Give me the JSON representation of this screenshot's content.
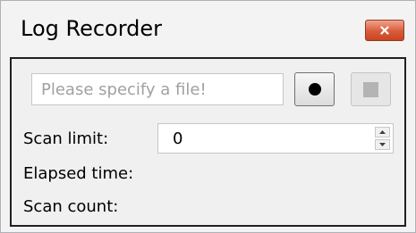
{
  "window": {
    "title": "Log Recorder"
  },
  "close_button": {
    "icon": "close-icon",
    "color": "#d95b3a"
  },
  "file": {
    "placeholder": "Please specify a file!",
    "value": ""
  },
  "toolbar": {
    "record_icon": "record-icon",
    "stop_icon": "stop-icon",
    "stop_enabled": false
  },
  "scan_limit": {
    "label": "Scan limit:",
    "value": "0"
  },
  "elapsed_time": {
    "label": "Elapsed time:",
    "value": ""
  },
  "scan_count": {
    "label": "Scan count:",
    "value": ""
  }
}
